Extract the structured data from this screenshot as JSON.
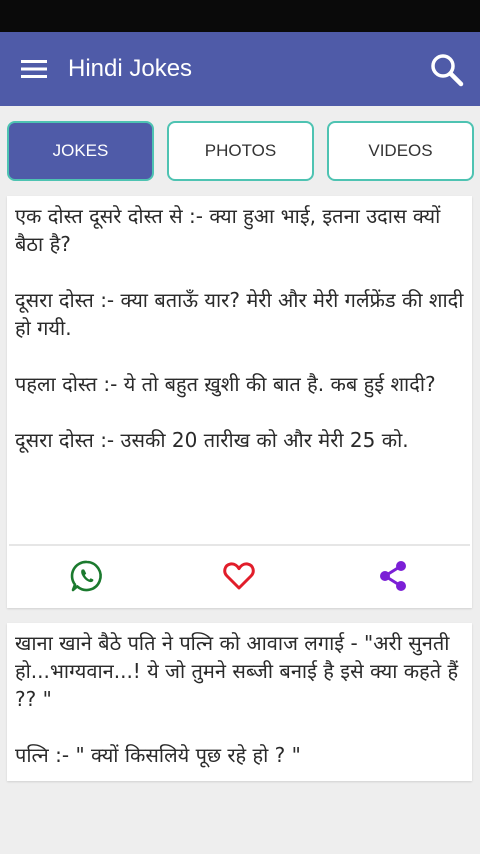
{
  "app": {
    "title": "Hindi Jokes"
  },
  "colors": {
    "appbar": "#4f5ba8",
    "tab_border": "#4ec3b2",
    "whatsapp": "#1b7a2e",
    "heart": "#e11d2a",
    "share": "#7b1fd6"
  },
  "icons": {
    "menu": "menu-icon",
    "search": "search-icon",
    "whatsapp": "whatsapp-icon",
    "favorite": "heart-icon",
    "share": "share-icon"
  },
  "tabs": [
    {
      "label": "JOKES",
      "active": true
    },
    {
      "label": "PHOTOS",
      "active": false
    },
    {
      "label": "VIDEOS",
      "active": false
    }
  ],
  "jokes": [
    {
      "text": "एक दोस्त दूसरे दोस्त से :- क्या हुआ भाई, इतना उदास क्यों बैठा है?\n\nदूसरा दोस्त :- क्या बताऊँ यार? मेरी और मेरी गर्लफ्रेंड की शादी हो गयी.\n\nपहला दोस्त :- ये तो बहुत ख़ुशी की बात है. कब हुई शादी?\n\nदूसरा दोस्त :- उसकी 20 तारीख को और मेरी 25 को."
    },
    {
      "text": "खाना खाने बैठे पति ने पत्नि को आवाज लगाई - \"अरी सुनती हो...भाग्यवान...! ये जो तुमने सब्जी बनाई है इसे क्या कहते हैं ?? \"\n\nपत्नि :- \" क्यों किसलिये पूछ रहे हो ? \""
    }
  ]
}
